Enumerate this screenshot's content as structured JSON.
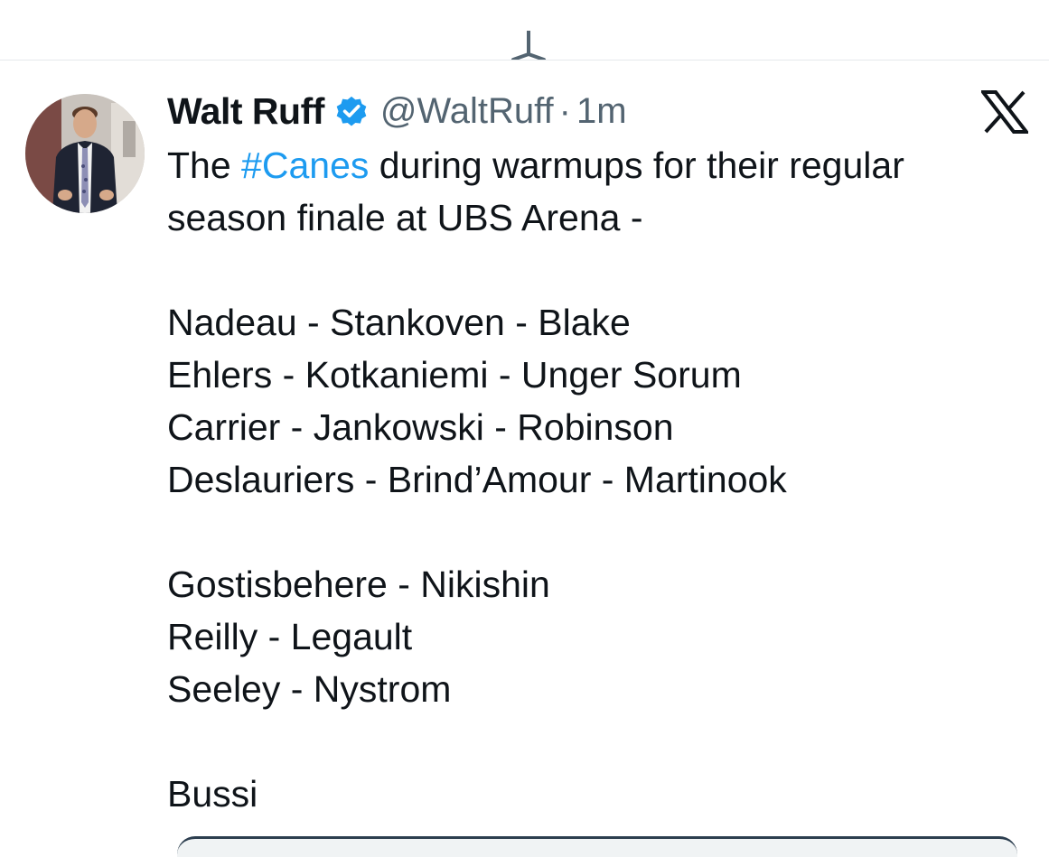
{
  "tweet": {
    "author": {
      "display_name": "Walt Ruff",
      "handle": "@WaltRuff",
      "verified": true
    },
    "separator": "·",
    "timestamp": "1m",
    "text": {
      "line1_pre": "The ",
      "hashtag": "#Canes",
      "line1_post": " during warmups for their regular",
      "line2": "season finale at UBS Arena -",
      "forwards": [
        "Nadeau - Stankoven - Blake",
        "Ehlers - Kotkaniemi - Unger Sorum",
        "Carrier - Jankowski - Robinson",
        "Deslauriers - Brind’Amour - Martinook"
      ],
      "defense": [
        "Gostisbehere - Nikishin",
        "Reilly - Legault",
        "Seeley - Nystrom"
      ],
      "goalie": "Bussi"
    }
  },
  "icons": {
    "refresh": "refresh-icon",
    "verified": "verified-badge-icon",
    "platform": "x-logo-icon"
  },
  "colors": {
    "text": "#0f1419",
    "secondary": "#536471",
    "link": "#1d9bf0",
    "verified": "#1d9bf0"
  }
}
